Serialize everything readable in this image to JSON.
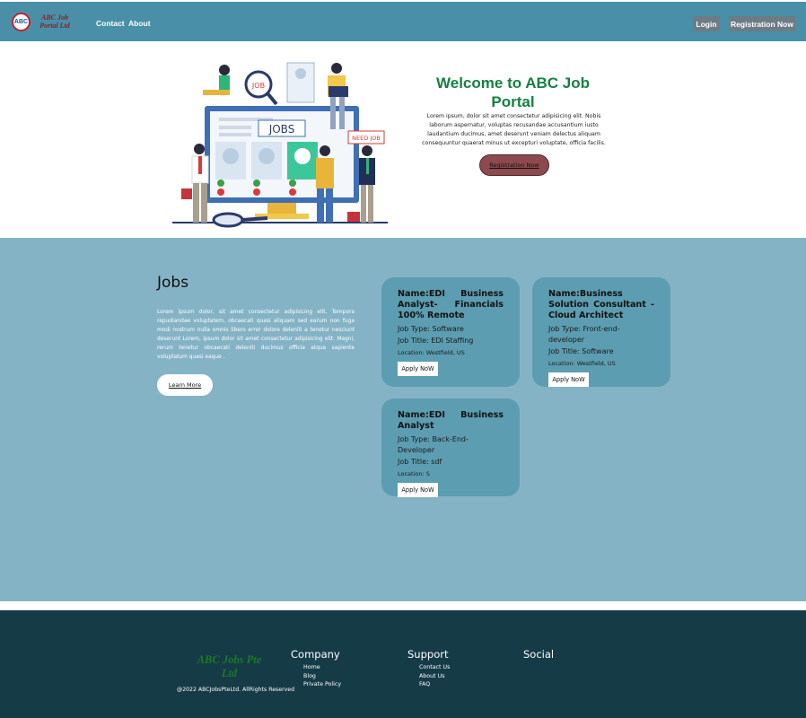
{
  "nav": {
    "logo_badge": "ABC",
    "logo_text": "ABC Job Portal Ltd",
    "links": [
      "Contact",
      "About"
    ],
    "login": "Login",
    "register": "Registration Now"
  },
  "hero": {
    "title": "Welcome to ABC Job Portal",
    "text": "Lorem ipsum, dolor sit amet consectetur adipisicing elit. Nobis laborum aspernatur, voluptas recusandae accusantium iusto laudantium ducimus, amet deserunt veniam delectus aliquam consequuntur quaerat minus ut excepturi voluptate, officia facilis.",
    "button": "Registration Now",
    "illustration": {
      "screen_label": "JOBS",
      "sign_label": "NEED JOB",
      "tag_label": "JOB"
    }
  },
  "jobs": {
    "title": "Jobs",
    "description": "Lorem ipsum dolor, sit amet consectetur adipisicing elit. Tempora repudiandae voluptatem, obcaecati quasi aliquam sed earum non fuga modi nostrum nulla omnis libero error dolore deleniti a tenetur nesciunt deserunt Lorem, ipsum dolor sit amet consectetur adipisicing elit. Magni, rerum tenetur obcaecati deleniti ducimus officia atque sapiente voluptatum quasi eaque .",
    "learn_more": "Learn More",
    "cards": [
      {
        "name": "Name:EDI Business Analyst- Financials 100% Remote",
        "type": "Job Type: Software",
        "title": "Job Title: EDI Staffing",
        "location": "Location: Westfield, US",
        "apply": "Apply NoW"
      },
      {
        "name": "Name:Business Solution Consultant - Cloud Architect",
        "type": "Job Type: Front-end-developer",
        "title": "Job Title: Software",
        "location": "Location: Westfield, US",
        "apply": "Apply NoW"
      },
      {
        "name": "Name:EDI Business Analyst",
        "type": "Job Type: Back-End-Developer",
        "title": "Job Title: sdf",
        "location": "Location: S",
        "apply": "Apply NoW"
      }
    ]
  },
  "footer": {
    "logo": "ABC Jobs Pte Ltd",
    "copyright": "@2022 ABCJobsPteLtd. AllRights Reserved",
    "company": {
      "heading": "Company",
      "links": [
        "Home",
        "Blog",
        "Private Policy"
      ]
    },
    "support": {
      "heading": "Support",
      "links": [
        "Contact Us",
        "About Us",
        "FAQ"
      ]
    },
    "social": {
      "heading": "Social"
    }
  },
  "colors": {
    "nav_bg": "#4a8fa8",
    "hero_title": "#168040",
    "hero_button": "#8c4a4f",
    "jobs_bg": "#85b3c6",
    "card_bg": "#5c9db1",
    "footer_bg": "#153b47",
    "footer_logo": "#1b7a22"
  }
}
